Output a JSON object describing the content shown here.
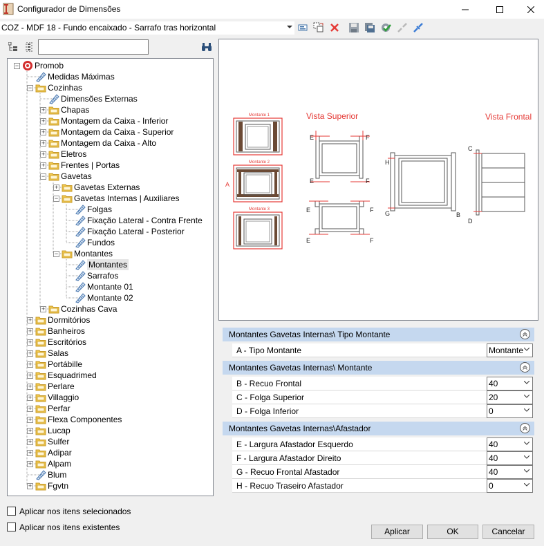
{
  "window": {
    "title": "Configurador de Dimensões"
  },
  "toolbar": {
    "combo_value": "COZ - MDF 18 - Fundo encaixado - Sarrafo tras horizontal"
  },
  "search": {
    "placeholder": ""
  },
  "tree": [
    {
      "label": "Promob",
      "level": 0,
      "expander": "minus",
      "icon": "promob-icon"
    },
    {
      "label": "Medidas Máximas",
      "level": 1,
      "expander": "none",
      "icon": "ruler-icon"
    },
    {
      "label": "Cozinhas",
      "level": 1,
      "expander": "minus",
      "icon": "folder-icon"
    },
    {
      "label": "Dimensões Externas",
      "level": 2,
      "expander": "none",
      "icon": "ruler-icon"
    },
    {
      "label": "Chapas",
      "level": 2,
      "expander": "plus",
      "icon": "folder-icon"
    },
    {
      "label": "Montagem da Caixa - Inferior",
      "level": 2,
      "expander": "plus",
      "icon": "folder-icon"
    },
    {
      "label": "Montagem da Caixa - Superior",
      "level": 2,
      "expander": "plus",
      "icon": "folder-icon"
    },
    {
      "label": "Montagem da Caixa - Alto",
      "level": 2,
      "expander": "plus",
      "icon": "folder-icon"
    },
    {
      "label": "Eletros",
      "level": 2,
      "expander": "plus",
      "icon": "folder-icon"
    },
    {
      "label": "Frentes | Portas",
      "level": 2,
      "expander": "plus",
      "icon": "folder-icon"
    },
    {
      "label": "Gavetas",
      "level": 2,
      "expander": "minus",
      "icon": "folder-icon"
    },
    {
      "label": "Gavetas Externas",
      "level": 3,
      "expander": "plus",
      "icon": "folder-icon"
    },
    {
      "label": "Gavetas Internas | Auxiliares",
      "level": 3,
      "expander": "minus",
      "icon": "folder-icon"
    },
    {
      "label": "Folgas",
      "level": 4,
      "expander": "none",
      "icon": "ruler-icon"
    },
    {
      "label": "Fixação Lateral - Contra Frente",
      "level": 4,
      "expander": "none",
      "icon": "ruler-icon"
    },
    {
      "label": "Fixação Lateral - Posterior",
      "level": 4,
      "expander": "none",
      "icon": "ruler-icon"
    },
    {
      "label": "Fundos",
      "level": 4,
      "expander": "none",
      "icon": "ruler-icon"
    },
    {
      "label": "Montantes",
      "level": 3,
      "expander": "minus",
      "icon": "folder-icon"
    },
    {
      "label": "Montantes",
      "level": 4,
      "expander": "none",
      "icon": "ruler-icon",
      "selected": true
    },
    {
      "label": "Sarrafos",
      "level": 4,
      "expander": "none",
      "icon": "ruler-icon"
    },
    {
      "label": "Montante 01",
      "level": 4,
      "expander": "none",
      "icon": "ruler-icon"
    },
    {
      "label": "Montante 02",
      "level": 4,
      "expander": "none",
      "icon": "ruler-icon"
    },
    {
      "label": "Cozinhas Cava",
      "level": 2,
      "expander": "plus",
      "icon": "folder-icon"
    },
    {
      "label": "Dormitórios",
      "level": 1,
      "expander": "plus",
      "icon": "folder-icon"
    },
    {
      "label": "Banheiros",
      "level": 1,
      "expander": "plus",
      "icon": "folder-icon"
    },
    {
      "label": "Escritórios",
      "level": 1,
      "expander": "plus",
      "icon": "folder-icon"
    },
    {
      "label": "Salas",
      "level": 1,
      "expander": "plus",
      "icon": "folder-icon"
    },
    {
      "label": "Portábille",
      "level": 1,
      "expander": "plus",
      "icon": "folder-icon"
    },
    {
      "label": "Esquadrimed",
      "level": 1,
      "expander": "plus",
      "icon": "folder-icon"
    },
    {
      "label": "Perlare",
      "level": 1,
      "expander": "plus",
      "icon": "folder-icon"
    },
    {
      "label": "Villaggio",
      "level": 1,
      "expander": "plus",
      "icon": "folder-icon"
    },
    {
      "label": "Perfar",
      "level": 1,
      "expander": "plus",
      "icon": "folder-icon"
    },
    {
      "label": "Flexa Componentes",
      "level": 1,
      "expander": "plus",
      "icon": "folder-icon"
    },
    {
      "label": "Lucap",
      "level": 1,
      "expander": "plus",
      "icon": "folder-icon"
    },
    {
      "label": "Sulfer",
      "level": 1,
      "expander": "plus",
      "icon": "folder-icon"
    },
    {
      "label": "Adipar",
      "level": 1,
      "expander": "plus",
      "icon": "folder-icon"
    },
    {
      "label": "Alpam",
      "level": 1,
      "expander": "plus",
      "icon": "folder-icon"
    },
    {
      "label": "Blum",
      "level": 1,
      "expander": "none",
      "icon": "ruler-icon"
    },
    {
      "label": "Fgvtn",
      "level": 1,
      "expander": "plus",
      "icon": "folder-icon"
    }
  ],
  "preview": {
    "montante1": "Montante 1",
    "montante2": "Montante 2",
    "montante3": "Montante 3",
    "label_a": "A",
    "vista_superior": "Vista Superior",
    "vista_frontal": "Vista Frontal",
    "label_b": "B",
    "label_c": "C",
    "label_d": "D",
    "label_e": "E",
    "label_f": "F",
    "label_g": "G",
    "label_h": "H"
  },
  "groups": [
    {
      "title": "Montantes Gavetas Internas\\  Tipo Montante",
      "props": [
        {
          "label": "A - Tipo Montante",
          "value": "Montante"
        }
      ]
    },
    {
      "title": "Montantes Gavetas Internas\\ Montante",
      "props": [
        {
          "label": "B - Recuo Frontal",
          "value": "40"
        },
        {
          "label": "C - Folga Superior",
          "value": "20"
        },
        {
          "label": "D - Folga Inferior",
          "value": "0"
        }
      ]
    },
    {
      "title": "Montantes Gavetas Internas\\Afastador",
      "props": [
        {
          "label": "E - Largura Afastador Esquerdo",
          "value": "40"
        },
        {
          "label": "F - Largura Afastador Direito",
          "value": "40"
        },
        {
          "label": "G - Recuo Frontal Afastador",
          "value": "40"
        },
        {
          "label": "H - Recuo Traseiro Afastador",
          "value": "0"
        }
      ]
    }
  ],
  "options": {
    "apply_selected": "Aplicar nos itens selecionados",
    "apply_existing": "Aplicar nos itens existentes"
  },
  "buttons": {
    "apply": "Aplicar",
    "ok": "OK",
    "cancel": "Cancelar"
  },
  "colors": {
    "accent_red": "#e53935",
    "group_header": "#c5d8ef",
    "folder": "#f2c94c"
  }
}
